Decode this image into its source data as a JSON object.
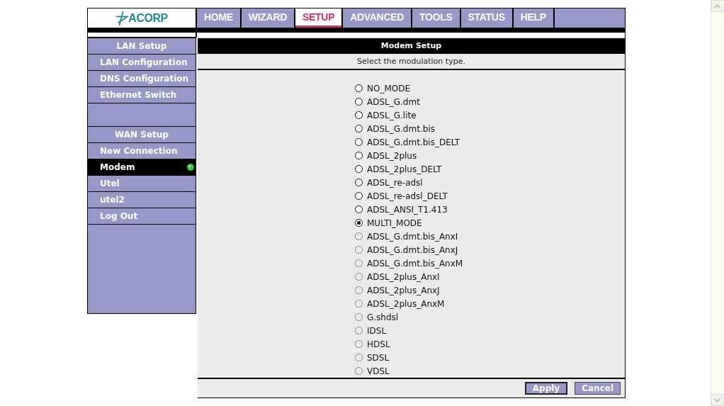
{
  "logo": "ACORP",
  "nav": [
    {
      "label": "HOME",
      "selected": false
    },
    {
      "label": "WIZARD",
      "selected": false
    },
    {
      "label": "SETUP",
      "selected": true
    },
    {
      "label": "ADVANCED",
      "selected": false
    },
    {
      "label": "TOOLS",
      "selected": false
    },
    {
      "label": "STATUS",
      "selected": false
    },
    {
      "label": "HELP",
      "selected": false
    }
  ],
  "sidebar": [
    {
      "kind": "header",
      "label": "LAN Setup"
    },
    {
      "kind": "item",
      "label": "LAN Configuration",
      "selected": false
    },
    {
      "kind": "item",
      "label": "DNS Configuration",
      "selected": false
    },
    {
      "kind": "item",
      "label": "Ethernet Switch",
      "selected": false
    },
    {
      "kind": "spacer"
    },
    {
      "kind": "header",
      "label": "WAN Setup"
    },
    {
      "kind": "item",
      "label": "New Connection",
      "selected": false
    },
    {
      "kind": "item",
      "label": "Modem",
      "selected": true
    },
    {
      "kind": "item",
      "label": "Utel",
      "selected": false
    },
    {
      "kind": "item",
      "label": "utel2",
      "selected": false
    },
    {
      "kind": "item",
      "label": "Log Out",
      "selected": false
    }
  ],
  "main": {
    "title": "Modem Setup",
    "subtitle": "Select the modulation type.",
    "options": [
      {
        "label": "NO_MODE",
        "selected": false,
        "disabled": false
      },
      {
        "label": "ADSL_G.dmt",
        "selected": false,
        "disabled": false
      },
      {
        "label": "ADSL_G.lite",
        "selected": false,
        "disabled": false
      },
      {
        "label": "ADSL_G.dmt.bis",
        "selected": false,
        "disabled": false
      },
      {
        "label": "ADSL_G.dmt.bis_DELT",
        "selected": false,
        "disabled": false
      },
      {
        "label": "ADSL_2plus",
        "selected": false,
        "disabled": false
      },
      {
        "label": "ADSL_2plus_DELT",
        "selected": false,
        "disabled": false
      },
      {
        "label": "ADSL_re-adsl",
        "selected": false,
        "disabled": false
      },
      {
        "label": "ADSL_re-adsl_DELT",
        "selected": false,
        "disabled": false
      },
      {
        "label": "ADSL_ANSI_T1.413",
        "selected": false,
        "disabled": false
      },
      {
        "label": "MULTI_MODE",
        "selected": true,
        "disabled": false
      },
      {
        "label": "ADSL_G.dmt.bis_AnxI",
        "selected": false,
        "disabled": true
      },
      {
        "label": "ADSL_G.dmt.bis_AnxJ",
        "selected": false,
        "disabled": true
      },
      {
        "label": "ADSL_G.dmt.bis_AnxM",
        "selected": false,
        "disabled": true
      },
      {
        "label": "ADSL_2plus_AnxI",
        "selected": false,
        "disabled": true
      },
      {
        "label": "ADSL_2plus_AnxJ",
        "selected": false,
        "disabled": true
      },
      {
        "label": "ADSL_2plus_AnxM",
        "selected": false,
        "disabled": true
      },
      {
        "label": "G.shdsl",
        "selected": false,
        "disabled": true
      },
      {
        "label": "IDSL",
        "selected": false,
        "disabled": true
      },
      {
        "label": "HDSL",
        "selected": false,
        "disabled": true
      },
      {
        "label": "SDSL",
        "selected": false,
        "disabled": true
      },
      {
        "label": "VDSL",
        "selected": false,
        "disabled": true
      }
    ],
    "buttons": [
      {
        "label": "Apply",
        "focused": true
      },
      {
        "label": "Cancel",
        "focused": false
      }
    ]
  }
}
